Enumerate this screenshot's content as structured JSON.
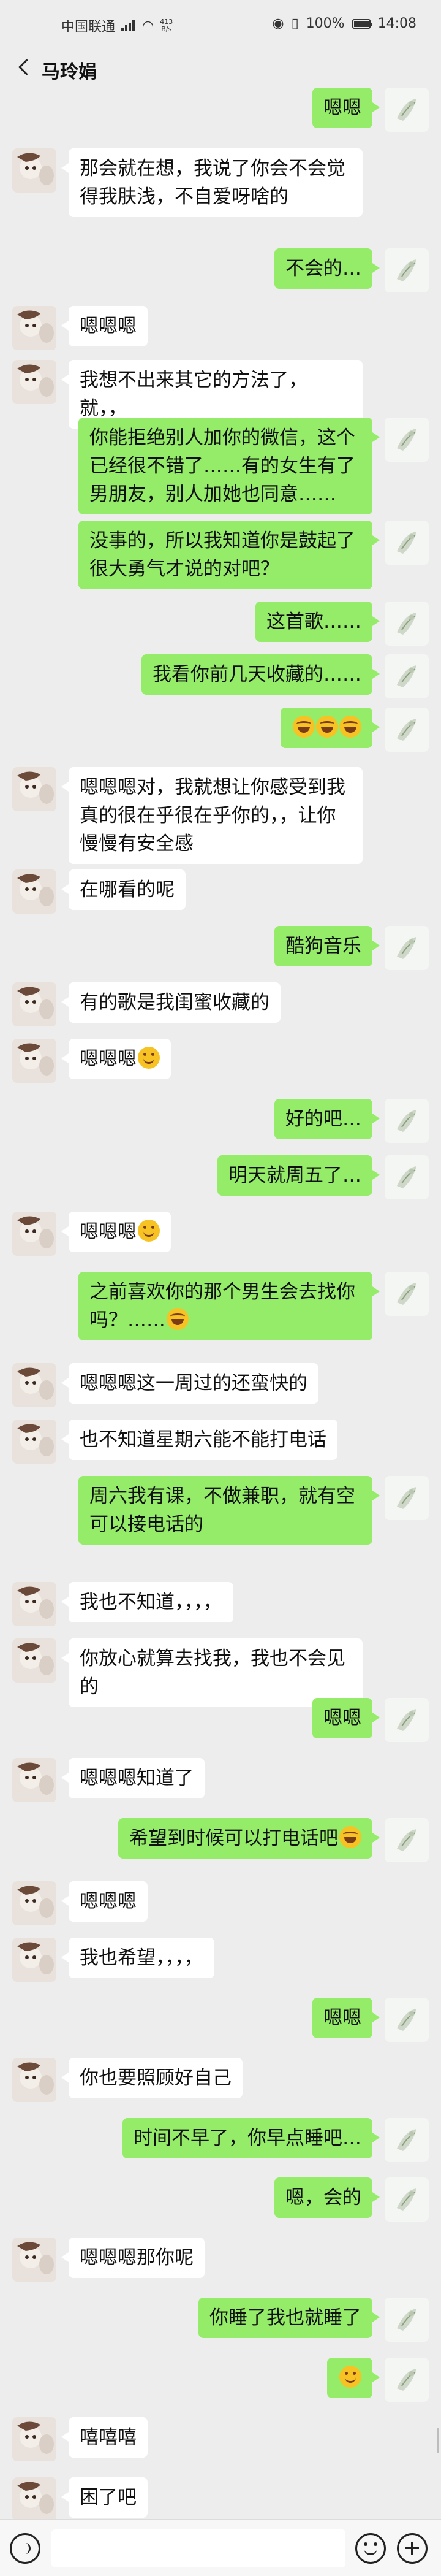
{
  "status_bar": {
    "carrier": "中国联通",
    "net_speed_value": "413",
    "net_speed_unit": "B/s",
    "battery": "100%",
    "time": "14:08"
  },
  "header": {
    "title": "马玲娟"
  },
  "messages": [
    {
      "side": "right",
      "text": "嗯嗯"
    },
    {
      "side": "left",
      "text": "那会就在想，我说了你会不会觉得我肤浅，不自爱呀啥的"
    },
    {
      "side": "right",
      "text": "不会的…"
    },
    {
      "side": "left",
      "text": "嗯嗯嗯"
    },
    {
      "side": "left",
      "text": "我想不出来其它的方法了，就，，"
    },
    {
      "side": "right",
      "text": "你能拒绝别人加你的微信，这个已经很不错了……有的女生有了男朋友，别人加她也同意……"
    },
    {
      "side": "right",
      "text": "没事的，所以我知道你是鼓起了很大勇气才说的对吧？"
    },
    {
      "side": "right",
      "text": "这首歌……"
    },
    {
      "side": "right",
      "text": "我看你前几天收藏的……"
    },
    {
      "side": "right",
      "text": "",
      "emoji": "laugh",
      "emoji_count": 3
    },
    {
      "side": "left",
      "text": "嗯嗯嗯对，我就想让你感受到我真的很在乎很在乎你的，，让你慢慢有安全感"
    },
    {
      "side": "left",
      "text": "在哪看的呢"
    },
    {
      "side": "right",
      "text": "酷狗音乐"
    },
    {
      "side": "left",
      "text": "有的歌是我闺蜜收藏的"
    },
    {
      "side": "left",
      "text": "嗯嗯嗯",
      "emoji": "smile",
      "emoji_count": 1
    },
    {
      "side": "right",
      "text": "好的吧…"
    },
    {
      "side": "right",
      "text": "明天就周五了…"
    },
    {
      "side": "left",
      "text": "嗯嗯嗯",
      "emoji": "smile",
      "emoji_count": 1
    },
    {
      "side": "right",
      "text": "之前喜欢你的那个男生会去找你吗？……",
      "emoji": "laugh",
      "emoji_count": 1
    },
    {
      "side": "left",
      "text": "嗯嗯嗯这一周过的还蛮快的"
    },
    {
      "side": "left",
      "text": "也不知道星期六能不能打电话"
    },
    {
      "side": "right",
      "text": "周六我有课，不做兼职，就有空可以接电话的"
    },
    {
      "side": "left",
      "text": "我也不知道，，，，"
    },
    {
      "side": "left",
      "text": "你放心就算去找我，我也不会见的"
    },
    {
      "side": "right",
      "text": "嗯嗯"
    },
    {
      "side": "left",
      "text": "嗯嗯嗯知道了"
    },
    {
      "side": "right",
      "text": "希望到时候可以打电话吧",
      "emoji": "laugh",
      "emoji_count": 1
    },
    {
      "side": "left",
      "text": "嗯嗯嗯"
    },
    {
      "side": "left",
      "text": "我也希望，，，，"
    },
    {
      "side": "right",
      "text": "嗯嗯"
    },
    {
      "side": "left",
      "text": "你也要照顾好自己"
    },
    {
      "side": "right",
      "text": "时间不早了，你早点睡吧…"
    },
    {
      "side": "right",
      "text": "嗯，会的"
    },
    {
      "side": "left",
      "text": "嗯嗯嗯那你呢"
    },
    {
      "side": "right",
      "text": "你睡了我也就睡了"
    },
    {
      "side": "right",
      "text": "",
      "emoji": "smile",
      "emoji_count": 1
    },
    {
      "side": "left",
      "text": "嘻嘻嘻"
    },
    {
      "side": "left",
      "text": "困了吧"
    }
  ],
  "input_bar": {
    "value": "",
    "placeholder": ""
  },
  "colors": {
    "background": "#ededed",
    "outgoing_bubble": "#95ec69",
    "incoming_bubble": "#ffffff"
  },
  "icons": {
    "back": "back-arrow-icon",
    "voice": "voice-icon",
    "emoji": "emoji-icon",
    "plus": "plus-icon"
  }
}
